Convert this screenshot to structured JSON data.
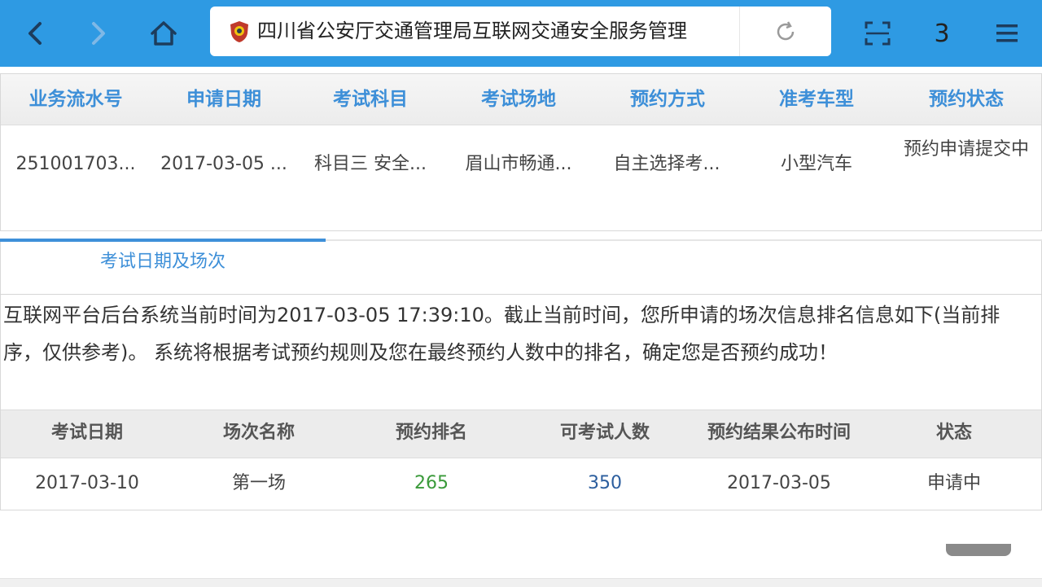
{
  "browser": {
    "address_text": "四川省公安厅交通管理局互联网交通安全服务管理",
    "tab_count": "3",
    "accent_color": "#2e9ae3",
    "icons": [
      "back-icon",
      "forward-icon",
      "home-icon",
      "police-badge-icon",
      "reload-icon",
      "scan-icon",
      "menu-icon"
    ]
  },
  "application_table": {
    "headers": [
      "业务流水号",
      "申请日期",
      "考试科目",
      "考试场地",
      "预约方式",
      "准考车型",
      "预约状态"
    ],
    "row": [
      "251001703...",
      "2017-03-05 ...",
      "科目三 安全...",
      "眉山市畅通...",
      "自主选择考...",
      "小型汽车",
      "预约申请提交中"
    ]
  },
  "tab": {
    "label": "考试日期及场次"
  },
  "notice": "互联网平台后台系统当前时间为2017-03-05 17:39:10。截止当前时间，您所申请的场次信息排名信息如下(当前排序，仅供参考)。 系统将根据考试预约规则及您在最终预约人数中的排名，确定您是否预约成功！",
  "session_table": {
    "headers": [
      "考试日期",
      "场次名称",
      "预约排名",
      "可考试人数",
      "预约结果公布时间",
      "状态"
    ],
    "row": [
      "2017-03-10",
      "第一场",
      "265",
      "350",
      "2017-03-05",
      "申请中"
    ]
  }
}
